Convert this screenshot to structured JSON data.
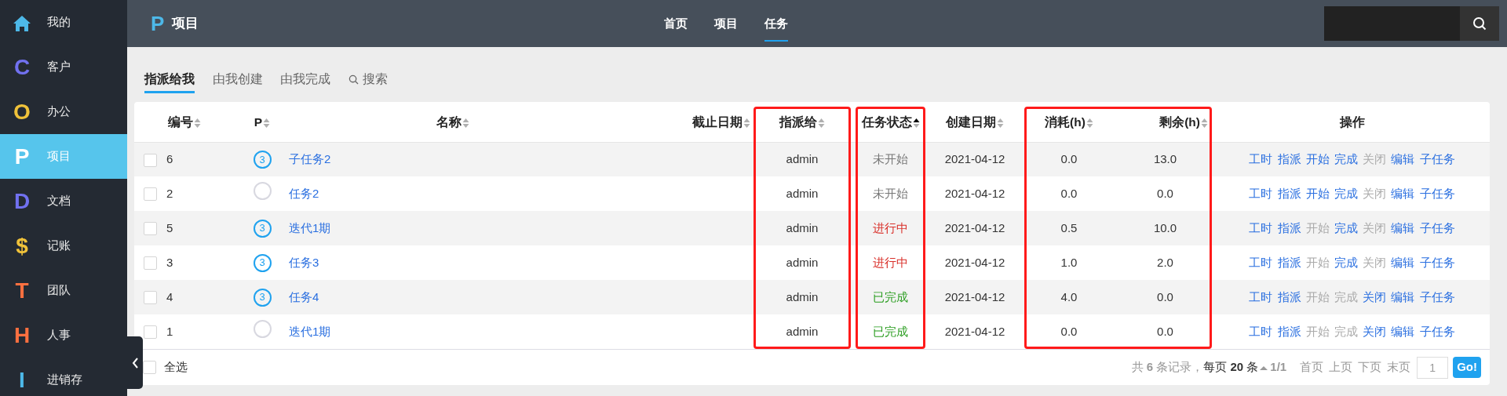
{
  "sidebar": {
    "items": [
      {
        "kind": "home",
        "label": "我的",
        "color": "#4db8e8",
        "selected": false
      },
      {
        "kind": "letter",
        "icon": "C",
        "label": "客户",
        "color": "#7171f0",
        "selected": false
      },
      {
        "kind": "letter",
        "icon": "O",
        "label": "办公",
        "color": "#f0c23a",
        "selected": false
      },
      {
        "kind": "letter",
        "icon": "P",
        "label": "项目",
        "color": "#ffffff",
        "selected": true
      },
      {
        "kind": "letter",
        "icon": "D",
        "label": "文档",
        "color": "#7171f0",
        "selected": false
      },
      {
        "kind": "letter",
        "icon": "$",
        "label": "记账",
        "color": "#f0c23a",
        "selected": false
      },
      {
        "kind": "letter",
        "icon": "T",
        "label": "团队",
        "color": "#ff7040",
        "selected": false
      },
      {
        "kind": "letter",
        "icon": "H",
        "label": "人事",
        "color": "#ff7040",
        "selected": false
      },
      {
        "kind": "letter",
        "icon": "I",
        "label": "进销存",
        "color": "#4db8e8",
        "selected": false
      }
    ]
  },
  "header": {
    "logo": "P",
    "title": "项目",
    "nav": [
      {
        "label": "首页",
        "selected": false
      },
      {
        "label": "项目",
        "selected": false
      },
      {
        "label": "任务",
        "selected": true
      }
    ]
  },
  "tabs": [
    {
      "label": "指派给我",
      "selected": true
    },
    {
      "label": "由我创建",
      "selected": false
    },
    {
      "label": "由我完成",
      "selected": false
    },
    {
      "label": "搜索",
      "selected": false,
      "kind": "search"
    }
  ],
  "table": {
    "columns": [
      {
        "label": "编号",
        "sorted_asc": false
      },
      {
        "label": "P",
        "sorted_asc": false
      },
      {
        "label": "名称",
        "sorted_asc": false
      },
      {
        "label": "截止日期",
        "sorted_asc": false
      },
      {
        "label": "指派给",
        "sorted_asc": false,
        "highlighted": true
      },
      {
        "label": "任务状态",
        "sorted_asc": true,
        "highlighted": true,
        "joined": false
      },
      {
        "label": "创建日期",
        "sorted_asc": false
      },
      {
        "label": "消耗(h)",
        "sorted_asc": false,
        "highlighted": true
      },
      {
        "label": "剩余(h)",
        "sorted_asc": false,
        "highlighted": true,
        "joined": true
      },
      {
        "label": "操作"
      }
    ],
    "rows": [
      {
        "checked": false,
        "id": "6",
        "priority": "3",
        "name": "子任务2",
        "assignee": "admin",
        "status": "未开始",
        "color": "#777777",
        "created": "2021-04-12",
        "consumed": "0.0",
        "remaining": "13.0",
        "actions": [
          {
            "label": "工时",
            "disabled": false
          },
          {
            "label": "指派",
            "disabled": false
          },
          {
            "label": "开始",
            "disabled": false
          },
          {
            "label": "完成",
            "disabled": false
          },
          {
            "label": "关闭",
            "disabled": true
          },
          {
            "label": "编辑",
            "disabled": false
          },
          {
            "label": "子任务",
            "disabled": false
          }
        ]
      },
      {
        "checked": false,
        "id": "2",
        "priority": null,
        "name": "任务2",
        "assignee": "admin",
        "status": "未开始",
        "color": "#777777",
        "created": "2021-04-12",
        "consumed": "0.0",
        "remaining": "0.0",
        "actions": [
          {
            "label": "工时",
            "disabled": false
          },
          {
            "label": "指派",
            "disabled": false
          },
          {
            "label": "开始",
            "disabled": false
          },
          {
            "label": "完成",
            "disabled": false
          },
          {
            "label": "关闭",
            "disabled": true
          },
          {
            "label": "编辑",
            "disabled": false
          },
          {
            "label": "子任务",
            "disabled": false
          }
        ]
      },
      {
        "checked": false,
        "id": "5",
        "priority": "3",
        "name": "迭代1期",
        "assignee": "admin",
        "status": "进行中",
        "color": "#d9302a",
        "created": "2021-04-12",
        "consumed": "0.5",
        "remaining": "10.0",
        "actions": [
          {
            "label": "工时",
            "disabled": false
          },
          {
            "label": "指派",
            "disabled": false
          },
          {
            "label": "开始",
            "disabled": true
          },
          {
            "label": "完成",
            "disabled": false
          },
          {
            "label": "关闭",
            "disabled": true
          },
          {
            "label": "编辑",
            "disabled": false
          },
          {
            "label": "子任务",
            "disabled": false
          }
        ]
      },
      {
        "checked": false,
        "id": "3",
        "priority": "3",
        "name": "任务3",
        "assignee": "admin",
        "status": "进行中",
        "color": "#d9302a",
        "created": "2021-04-12",
        "consumed": "1.0",
        "remaining": "2.0",
        "actions": [
          {
            "label": "工时",
            "disabled": false
          },
          {
            "label": "指派",
            "disabled": false
          },
          {
            "label": "开始",
            "disabled": true
          },
          {
            "label": "完成",
            "disabled": false
          },
          {
            "label": "关闭",
            "disabled": true
          },
          {
            "label": "编辑",
            "disabled": false
          },
          {
            "label": "子任务",
            "disabled": false
          }
        ]
      },
      {
        "checked": false,
        "id": "4",
        "priority": "3",
        "name": "任务4",
        "assignee": "admin",
        "status": "已完成",
        "color": "#2a9d20",
        "created": "2021-04-12",
        "consumed": "4.0",
        "remaining": "0.0",
        "actions": [
          {
            "label": "工时",
            "disabled": false
          },
          {
            "label": "指派",
            "disabled": false
          },
          {
            "label": "开始",
            "disabled": true
          },
          {
            "label": "完成",
            "disabled": true
          },
          {
            "label": "关闭",
            "disabled": false
          },
          {
            "label": "编辑",
            "disabled": false
          },
          {
            "label": "子任务",
            "disabled": false
          }
        ]
      },
      {
        "checked": false,
        "id": "1",
        "priority": null,
        "name": "迭代1期",
        "assignee": "admin",
        "status": "已完成",
        "color": "#2a9d20",
        "created": "2021-04-12",
        "consumed": "0.0",
        "remaining": "0.0",
        "actions": [
          {
            "label": "工时",
            "disabled": false
          },
          {
            "label": "指派",
            "disabled": false
          },
          {
            "label": "开始",
            "disabled": true
          },
          {
            "label": "完成",
            "disabled": true
          },
          {
            "label": "关闭",
            "disabled": false
          },
          {
            "label": "编辑",
            "disabled": false
          },
          {
            "label": "子任务",
            "disabled": false
          }
        ]
      }
    ]
  },
  "footer": {
    "select_all": {
      "label": "全选",
      "checked": false
    },
    "total": "共 **6** 条记录，",
    "per_page": "每页 **20** 条",
    "page": "1/1",
    "links": [
      {
        "label": "首页",
        "disabled": true
      },
      {
        "label": "上页",
        "disabled": true
      },
      {
        "label": "下页",
        "disabled": true
      },
      {
        "label": "末页",
        "disabled": true
      }
    ],
    "page_input": "1",
    "go": "Go!"
  }
}
